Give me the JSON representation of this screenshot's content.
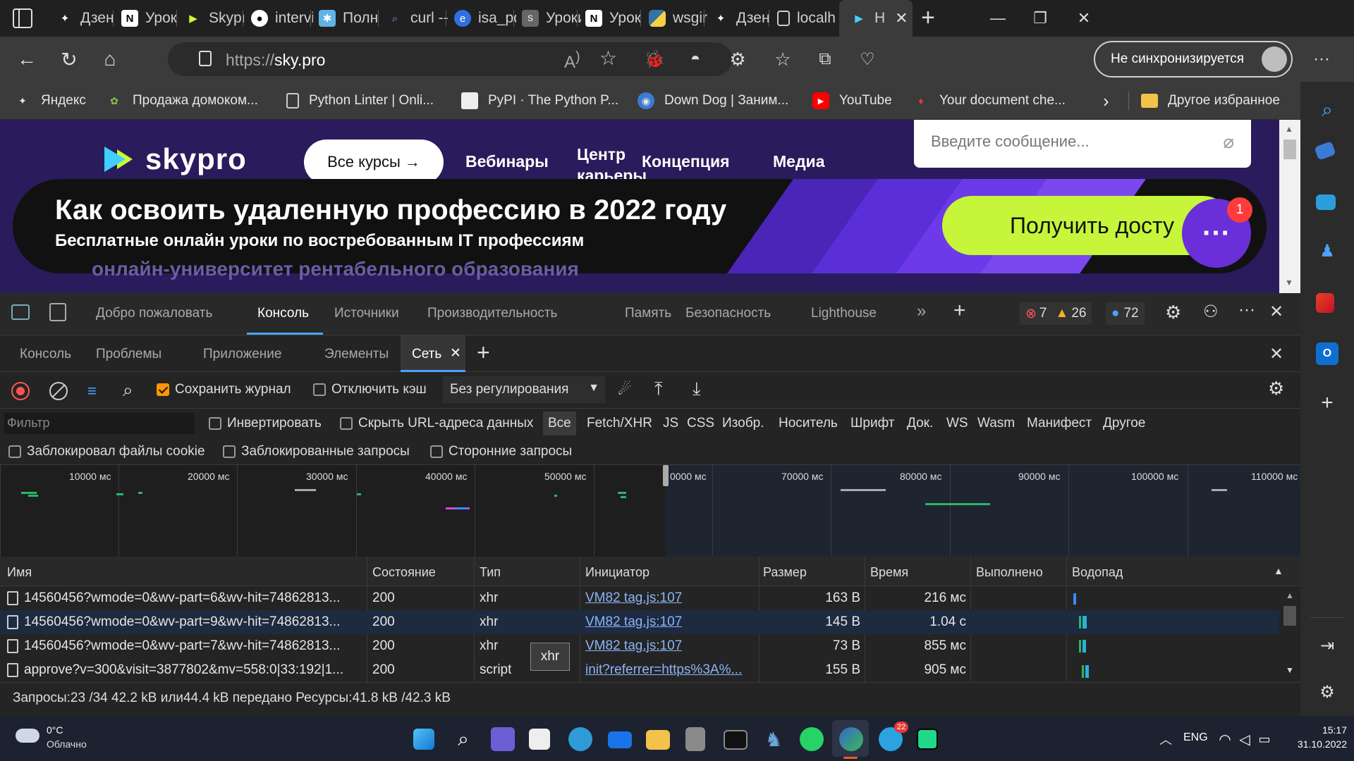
{
  "browser": {
    "tabs": [
      {
        "label": "Дзен",
        "icon": "zen-icon"
      },
      {
        "label": "Урок",
        "icon": "notion-icon"
      },
      {
        "label": "Skypro",
        "icon": "skypro-icon"
      },
      {
        "label": "intervi",
        "icon": "github-icon"
      },
      {
        "label": "Полн",
        "icon": "app-icon"
      },
      {
        "label": "curl --",
        "icon": "search-icon"
      },
      {
        "label": "isa_pd",
        "icon": "edge-icon"
      },
      {
        "label": "Уроки",
        "icon": "page-icon"
      },
      {
        "label": "Урок",
        "icon": "notion-icon"
      },
      {
        "label": "wsgire",
        "icon": "python-icon"
      },
      {
        "label": "Дзен",
        "icon": "zen-icon"
      },
      {
        "label": "localh",
        "icon": "page-icon"
      },
      {
        "label": "Н",
        "icon": "skypro-icon",
        "active": true
      }
    ],
    "address": {
      "scheme": "https://",
      "host": "sky.pro"
    },
    "sync_label": "Не синхронизируется",
    "bookmarks": [
      {
        "label": "Яндекс",
        "icon": "yandex-icon"
      },
      {
        "label": "Продажа домоком...",
        "icon": "leaf-icon"
      },
      {
        "label": "Python Linter | Onli...",
        "icon": "page-icon"
      },
      {
        "label": "PyPI · The Python P...",
        "icon": "cube-icon"
      },
      {
        "label": "Down Dog | Заним...",
        "icon": "dog-icon"
      },
      {
        "label": "YouTube",
        "icon": "youtube-icon"
      },
      {
        "label": "Your document che...",
        "icon": "maple-icon"
      },
      {
        "label": "Другое избранное",
        "icon": "folder-icon"
      }
    ]
  },
  "page": {
    "logo": "skypro",
    "nav": {
      "all_courses": "Все курсы →",
      "webinars": "Вебинары",
      "center": "Центр",
      "center2": "карьеры",
      "concept": "Концепция",
      "media": "Медиа"
    },
    "chat_placeholder": "Введите сообщение...",
    "banner_title": "Как освоить удаленную профессию в 2022 году",
    "banner_subtitle": "Бесплатные онлайн уроки по востребованным IT профессиям",
    "cta": "Получить досту",
    "chat_badge": "1",
    "footer_text": "онлайн-университет рентабельного образования"
  },
  "devtools": {
    "main_tabs": [
      "Добро пожаловать",
      "Консоль",
      "Источники",
      "Производительность",
      "Память",
      "Безопасность",
      "Lighthouse"
    ],
    "selected_main": "Консоль",
    "errors": "7",
    "warnings": "26",
    "messages": "72",
    "drawer_tabs": [
      "Консоль",
      "Проблемы",
      "Приложение",
      "Элементы",
      "Сеть"
    ],
    "network": {
      "preserve_log": "Сохранить журнал",
      "disable_cache": "Отключить кэш",
      "throttling": "Без регулирования",
      "filter_placeholder": "Фильтр",
      "invert": "Инвертировать",
      "hide_data_urls": "Скрыть URL-адреса данных",
      "types": [
        "Все",
        "Fetch/XHR",
        "JS",
        "CSS",
        "Изобр.",
        "Носитель",
        "Шрифт",
        "Док.",
        "WS",
        "Wasm",
        "Манифест",
        "Другое"
      ],
      "blocked_cookies": "Заблокировал файлы cookie",
      "blocked_requests": "Заблокированные запросы",
      "third_party": "Сторонние запросы",
      "timeline_ticks": [
        "10000 мс",
        "20000 мс",
        "30000 мс",
        "40000 мс",
        "50000 мс",
        "0000 мс",
        "70000 мс",
        "80000 мс",
        "90000 мс",
        "100000 мс",
        "110000 мс"
      ],
      "columns": [
        "Имя",
        "Состояние",
        "Тип",
        "Инициатор",
        "Размер",
        "Время",
        "Выполнено",
        "Водопад"
      ],
      "rows": [
        {
          "name": "14560456?wmode=0&wv-part=6&wv-hit=74862813...",
          "status": "200",
          "type": "xhr",
          "initiator": "VM82 tag.js:107",
          "size": "163 B",
          "time": "216 мс",
          "done": ""
        },
        {
          "name": "14560456?wmode=0&wv-part=9&wv-hit=74862813...",
          "status": "200",
          "type": "xhr",
          "initiator": "VM82 tag.js:107",
          "size": "145 B",
          "time": "1.04 с",
          "done": ""
        },
        {
          "name": "14560456?wmode=0&wv-part=7&wv-hit=74862813...",
          "status": "200",
          "type": "xhr",
          "initiator": "VM82 tag.js:107",
          "size": "73 B",
          "time": "855 мс",
          "done": ""
        },
        {
          "name": "approve?v=300&visit=3877802&mv=558:0|33:192|1...",
          "status": "200",
          "type": "script",
          "initiator": "init?referrer=https%3A%...",
          "size": "155 B",
          "time": "905 мс",
          "done": ""
        }
      ],
      "tooltip": "xhr",
      "status": "Запросы:23 /34  42.2 kB или44.4 kB передано  Ресурсы:41.8 kB /42.3 kB"
    }
  },
  "taskbar": {
    "weather_temp": "0°C",
    "weather_desc": "Облачно",
    "lang": "ENG",
    "time": "15:17",
    "date": "31.10.2022",
    "telegram_badge": "22"
  }
}
